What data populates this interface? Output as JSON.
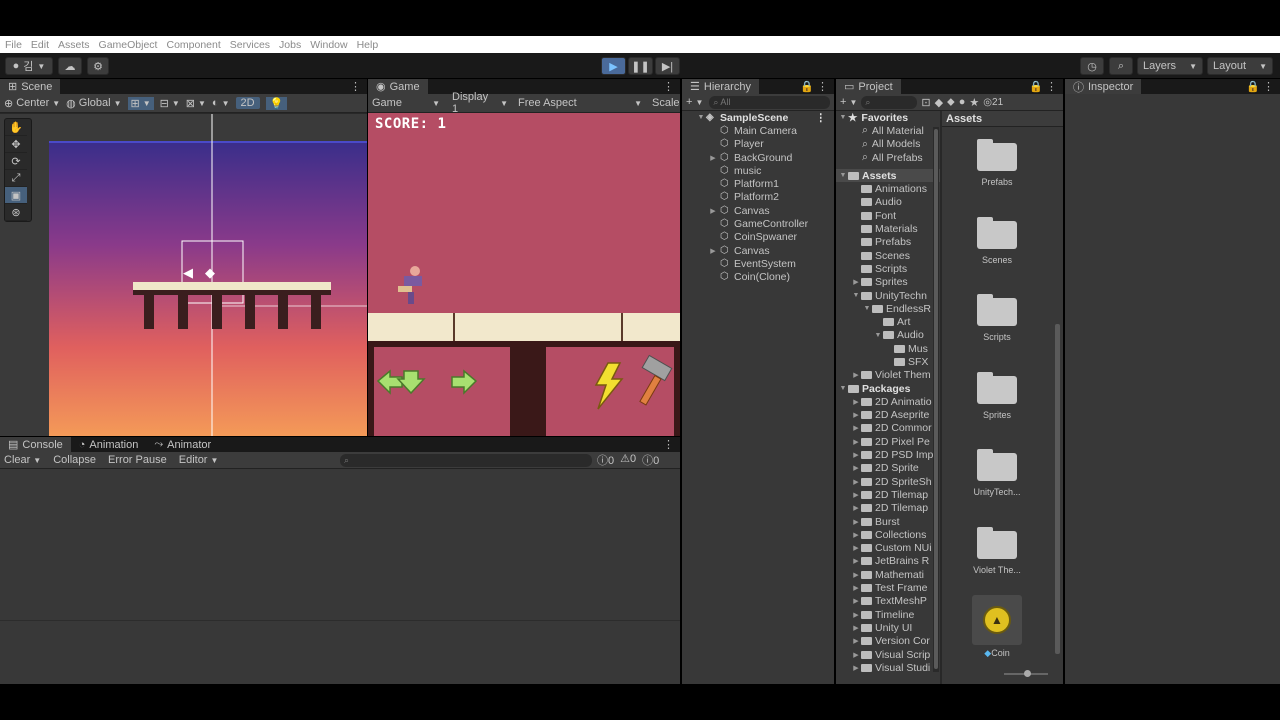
{
  "menu": [
    "File",
    "Edit",
    "Assets",
    "GameObject",
    "Component",
    "Services",
    "Jobs",
    "Window",
    "Help"
  ],
  "toolbar": {
    "account_label": "김",
    "layers_label": "Layers",
    "layout_label": "Layout"
  },
  "scene": {
    "tab_label": "Scene",
    "pivot_label": "Center",
    "space_label": "Global",
    "mode_2d_label": "2D"
  },
  "game": {
    "tab_label": "Game",
    "view_label": "Game",
    "display_label": "Display 1",
    "aspect_label": "Free Aspect",
    "scale_label": "Scale",
    "score_text": "SCORE: 1"
  },
  "hierarchy": {
    "tab_label": "Hierarchy",
    "search_placeholder": "All",
    "scene_name": "SampleScene",
    "items": [
      {
        "label": "Main Camera",
        "foldable": false
      },
      {
        "label": "Player",
        "foldable": false
      },
      {
        "label": "BackGround",
        "foldable": true
      },
      {
        "label": "music",
        "foldable": false
      },
      {
        "label": "Platform1",
        "foldable": false
      },
      {
        "label": "Platform2",
        "foldable": false
      },
      {
        "label": "Canvas",
        "foldable": true
      },
      {
        "label": "GameController",
        "foldable": false
      },
      {
        "label": "CoinSpwaner",
        "foldable": false
      },
      {
        "label": "Canvas",
        "foldable": true
      },
      {
        "label": "EventSystem",
        "foldable": false
      },
      {
        "label": "Coin(Clone)",
        "foldable": false
      }
    ]
  },
  "project": {
    "tab_label": "Project",
    "hidden_count": "21",
    "favorites_label": "Favorites",
    "favorites": [
      "All Material",
      "All Models",
      "All Prefabs"
    ],
    "assets_label": "Assets",
    "asset_tree": [
      {
        "label": "Animations",
        "indent": 1,
        "fold": ""
      },
      {
        "label": "Audio",
        "indent": 1,
        "fold": ""
      },
      {
        "label": "Font",
        "indent": 1,
        "fold": ""
      },
      {
        "label": "Materials",
        "indent": 1,
        "fold": ""
      },
      {
        "label": "Prefabs",
        "indent": 1,
        "fold": ""
      },
      {
        "label": "Scenes",
        "indent": 1,
        "fold": ""
      },
      {
        "label": "Scripts",
        "indent": 1,
        "fold": ""
      },
      {
        "label": "Sprites",
        "indent": 1,
        "fold": "▶"
      },
      {
        "label": "UnityTechn",
        "indent": 1,
        "fold": "▼"
      },
      {
        "label": "EndlessR",
        "indent": 2,
        "fold": "▼"
      },
      {
        "label": "Art",
        "indent": 3,
        "fold": ""
      },
      {
        "label": "Audio",
        "indent": 3,
        "fold": "▼"
      },
      {
        "label": "Mus",
        "indent": 4,
        "fold": ""
      },
      {
        "label": "SFX",
        "indent": 4,
        "fold": ""
      },
      {
        "label": "Violet Them",
        "indent": 1,
        "fold": "▶"
      }
    ],
    "packages_label": "Packages",
    "packages": [
      "2D Animatio",
      "2D Aseprite",
      "2D Commor",
      "2D Pixel Pe",
      "2D PSD Imp",
      "2D Sprite",
      "2D SpriteSh",
      "2D Tilemap",
      "2D Tilemap",
      "Burst",
      "Collections",
      "Custom NUi",
      "JetBrains R",
      "Mathemati",
      "Test Frame",
      "TextMeshP",
      "Timeline",
      "Unity UI",
      "Version Cor",
      "Visual Scrip",
      "Visual Studi"
    ],
    "grid_header": "Assets",
    "grid_items": [
      "Prefabs",
      "Scenes",
      "Scripts",
      "Sprites",
      "UnityTech...",
      "Violet The..."
    ],
    "coin_label": "Coin"
  },
  "inspector": {
    "tab_label": "Inspector"
  },
  "console": {
    "tabs": [
      "Console",
      "Animation",
      "Animator"
    ],
    "clear_label": "Clear",
    "collapse_label": "Collapse",
    "error_pause_label": "Error Pause",
    "editor_label": "Editor",
    "log_count": "0",
    "warn_count": "0",
    "error_count": "0"
  },
  "colors": {
    "play_active": "#4a6a9a",
    "panel_bg": "#383838",
    "game_bg": "#b54d64",
    "selection": "#2c5d87"
  }
}
